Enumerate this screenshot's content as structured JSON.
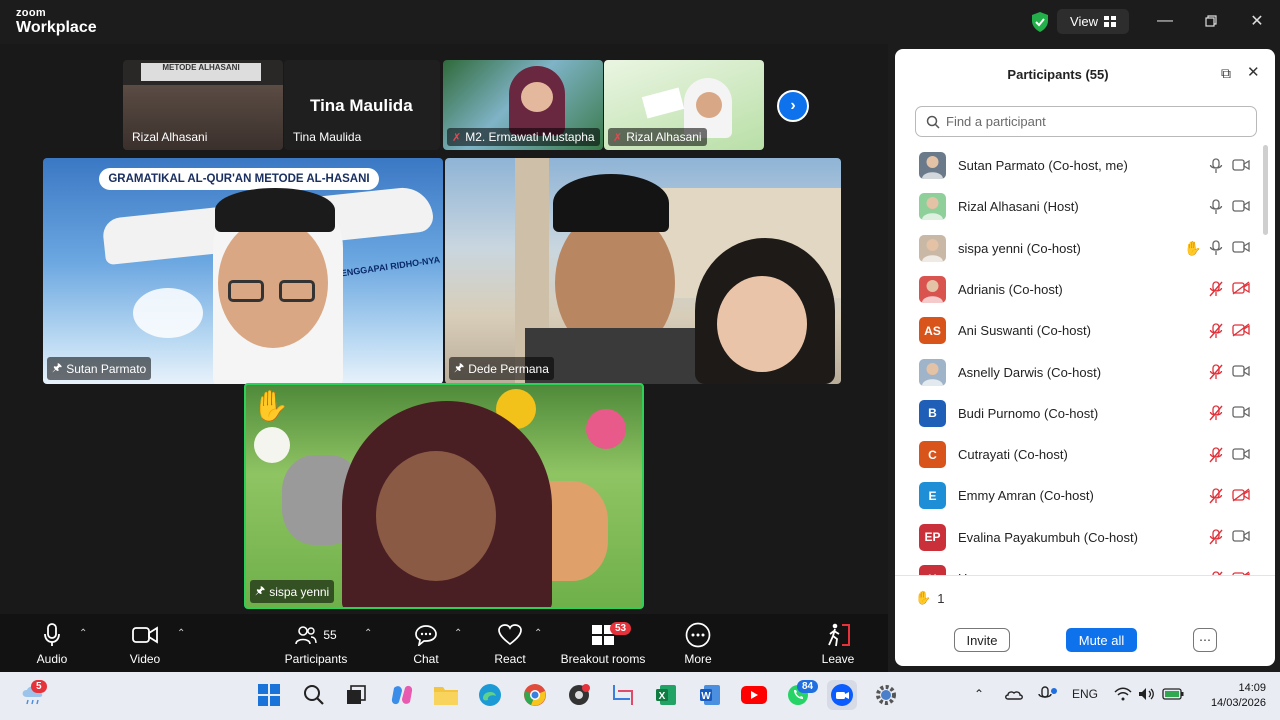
{
  "app": {
    "brand_small": "zoom",
    "brand_big": "Workplace",
    "view_label": "View"
  },
  "videos": {
    "thumb1_name": "Rizal Alhasani",
    "thumb1_banner": "METODE ALHASANI",
    "thumb2_name": "Tina Maulida",
    "thumb2_big": "Tina Maulida",
    "thumb3_name": "M2. Ermawati Mustapha",
    "thumb4_name": "Rizal Alhasani",
    "tile1_name": "Sutan Parmato",
    "tile1_banner": "GRAMATIKAL AL-QUR'AN METODE AL-HASANI",
    "tile1_plane_text": "MENGGAPAI RIDHO-NYA",
    "tile2_name": "Dede Permana",
    "tile3_name": "sispa yenni"
  },
  "controls": {
    "audio": "Audio",
    "video": "Video",
    "participants": "Participants",
    "participants_count": "55",
    "chat": "Chat",
    "react": "React",
    "breakout": "Breakout rooms",
    "breakout_badge": "53",
    "more": "More",
    "leave": "Leave"
  },
  "panel": {
    "title": "Participants (55)",
    "search_placeholder": "Find a participant",
    "participants": [
      {
        "name": "Sutan Parmato (Co-host, me)",
        "initials": "",
        "color": "#6a7a8a",
        "mic": "on",
        "cam": "on",
        "hand": false
      },
      {
        "name": "Rizal Alhasani (Host)",
        "initials": "",
        "color": "#8fcf9a",
        "mic": "on",
        "cam": "on",
        "hand": false
      },
      {
        "name": "sispa yenni (Co-host)",
        "initials": "",
        "color": "#c9b8a6",
        "mic": "on",
        "cam": "on",
        "hand": true
      },
      {
        "name": "Adrianis (Co-host)",
        "initials": "",
        "color": "#d9534f",
        "mic": "off",
        "cam": "off",
        "hand": false
      },
      {
        "name": "Ani Suswanti (Co-host)",
        "initials": "AS",
        "color": "#d8541a",
        "mic": "off",
        "cam": "off",
        "hand": false
      },
      {
        "name": "Asnelly Darwis (Co-host)",
        "initials": "",
        "color": "#9fb4c9",
        "mic": "off",
        "cam": "on",
        "hand": false
      },
      {
        "name": "Budi Purnomo (Co-host)",
        "initials": "B",
        "color": "#1f5fb8",
        "mic": "off",
        "cam": "on",
        "hand": false
      },
      {
        "name": "Cutrayati (Co-host)",
        "initials": "C",
        "color": "#d8541a",
        "mic": "off",
        "cam": "on",
        "hand": false
      },
      {
        "name": "Emmy Amran (Co-host)",
        "initials": "E",
        "color": "#1e8fd6",
        "mic": "off",
        "cam": "off",
        "hand": false
      },
      {
        "name": "Evalina Payakumbuh (Co-host)",
        "initials": "EP",
        "color": "#c9303a",
        "mic": "off",
        "cam": "on",
        "hand": false
      },
      {
        "name": "H",
        "initials": "H",
        "color": "#c9303a",
        "mic": "off",
        "cam": "off",
        "hand": false
      }
    ],
    "hand_count": "1",
    "invite": "Invite",
    "mute_all": "Mute all"
  },
  "taskbar": {
    "notif_badge": "5",
    "whatsapp_badge": "84",
    "lang": "ENG",
    "time": "14:09",
    "date": "14/03/2026"
  }
}
